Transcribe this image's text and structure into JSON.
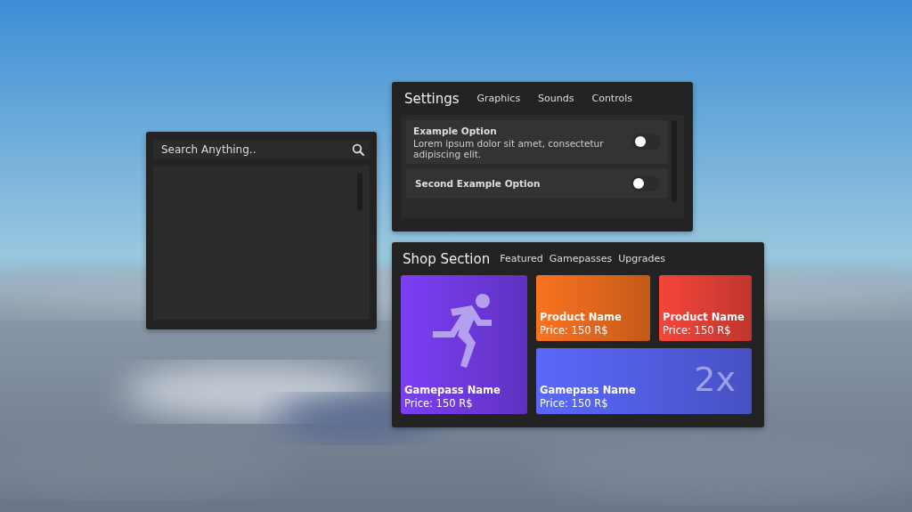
{
  "search_window": {
    "search": {
      "placeholder": "Search Anything.."
    }
  },
  "settings_window": {
    "title": "Settings",
    "tabs": [
      {
        "label": "Graphics"
      },
      {
        "label": "Sounds"
      },
      {
        "label": "Controls"
      }
    ],
    "options": [
      {
        "name": "Example Option",
        "description": "Lorem ipsum dolor sit amet, consectetur adipiscing elit.",
        "on": false
      },
      {
        "name": "Second Example Option",
        "on": false
      }
    ]
  },
  "shop_window": {
    "title": "Shop Section",
    "tabs": [
      {
        "label": "Featured"
      },
      {
        "label": "Gamepasses"
      },
      {
        "label": "Upgrades"
      }
    ],
    "items": [
      {
        "kind": "tall",
        "name": "Gamepass Name",
        "price": "Price: 150 R$",
        "color": "#7b3ff5"
      },
      {
        "kind": "small",
        "name": "Product Name",
        "price": "Price: 150 R$",
        "color": "#fa7320"
      },
      {
        "kind": "small",
        "name": "Product Name",
        "price": "Price: 150 R$",
        "color": "#f5453a"
      },
      {
        "kind": "wide",
        "name": "Gamepass Name",
        "price": "Price: 150 R$",
        "color": "#5a68fa",
        "badge": "2x"
      }
    ]
  }
}
